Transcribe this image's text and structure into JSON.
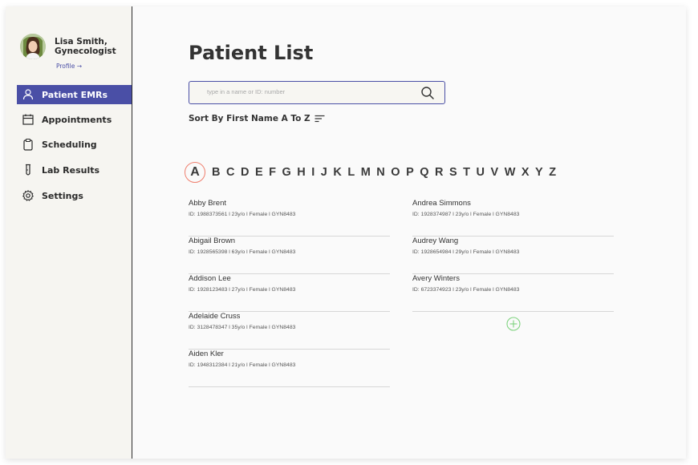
{
  "user": {
    "name_line1": "Lisa Smith,",
    "name_line2": "Gynecologist",
    "profile_link": "Profile →"
  },
  "nav": [
    {
      "label": "Patient EMRs",
      "icon": "user-icon",
      "active": true
    },
    {
      "label": "Appointments",
      "icon": "calendar-icon",
      "active": false
    },
    {
      "label": "Scheduling",
      "icon": "clipboard-icon",
      "active": false
    },
    {
      "label": "Lab Results",
      "icon": "test-tube-icon",
      "active": false
    },
    {
      "label": "Settings",
      "icon": "gear-icon",
      "active": false
    }
  ],
  "page": {
    "title": "Patient List"
  },
  "search": {
    "placeholder": "type in a name or ID: number",
    "value": ""
  },
  "sort": {
    "label": "Sort By First Name A To Z"
  },
  "alphabet": {
    "letters": [
      "A",
      "B",
      "C",
      "D",
      "E",
      "F",
      "G",
      "H",
      "I",
      "J",
      "K",
      "L",
      "M",
      "N",
      "O",
      "P",
      "Q",
      "R",
      "S",
      "T",
      "U",
      "V",
      "W",
      "X",
      "Y",
      "Z"
    ],
    "selected": "A"
  },
  "patients_left": [
    {
      "name": "Abby Brent",
      "meta": "ID: 1988373561 l 23y/o  l  Female  l GYN8483"
    },
    {
      "name": "Abigail Brown",
      "meta": "ID: 1928565398 l 63y/o l  Female  l GYN8483"
    },
    {
      "name": "Addison Lee",
      "meta": "ID: 1928123483 l 27y/o  l  Female  l GYN8483"
    },
    {
      "name": "Adelaide Cruss",
      "meta": "ID: 3128478347 l 35y/o  l  Female  l GYN8483"
    },
    {
      "name": "Aiden Kler",
      "meta": "ID: 1948312384 l 21y/o  l  Female  l GYN8483"
    }
  ],
  "patients_right": [
    {
      "name": "Andrea Simmons",
      "meta": "ID: 1928374987 l 23y/o  l  Female  l GYN8483"
    },
    {
      "name": "Audrey Wang",
      "meta": "ID: 1928654984 l 29y/o  l  Female  l GYN8483"
    },
    {
      "name": "Avery Winters",
      "meta": "ID: 6723374923 l 23y/o  l  Female  l GYN8483"
    }
  ],
  "colors": {
    "accent": "#4a4fa6",
    "selected_letter_ring": "#ef7f6e",
    "add_button": "#7fd37f"
  }
}
